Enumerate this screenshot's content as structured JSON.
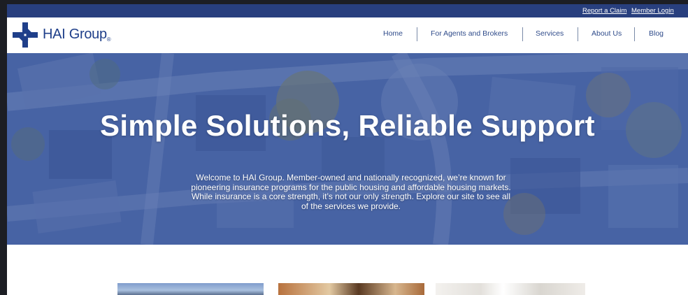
{
  "utility_nav": {
    "report_claim": "Report a Claim",
    "member_login": "Member Login"
  },
  "brand": {
    "name": "HAI Group",
    "registered_mark": "®",
    "primary_color": "#1f3f8a",
    "bar_color": "#283f7e"
  },
  "nav": {
    "items": [
      {
        "label": "Home"
      },
      {
        "label": "For Agents and Brokers"
      },
      {
        "label": "Services"
      },
      {
        "label": "About Us"
      },
      {
        "label": "Blog"
      }
    ]
  },
  "hero": {
    "title": "Simple Solutions, Reliable Support",
    "body": "Welcome to HAI Group. Member-owned and nationally recognized, we’re known for pioneering insurance programs for the public housing and affordable housing markets. While insurance is a core strength, it’s not our only strength. Explore our site to see all of the services we provide.",
    "overlay_color": "#3e5aa0"
  },
  "icons": {
    "logo": "hai-cross-logo-icon"
  }
}
